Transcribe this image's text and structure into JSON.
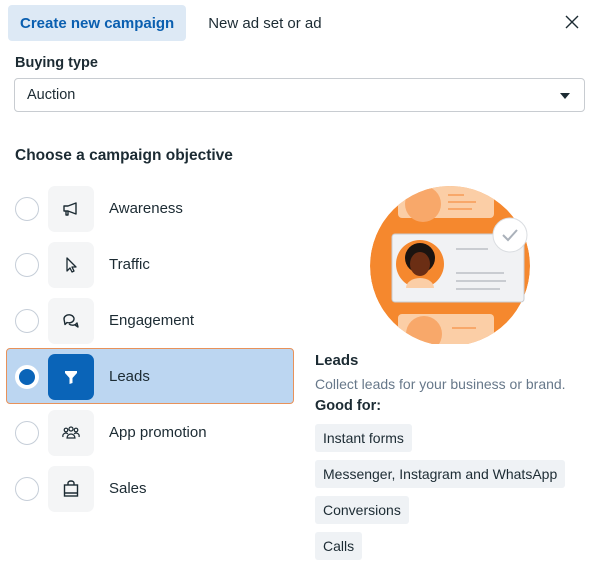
{
  "tabs": [
    {
      "label": "Create new campaign",
      "active": true
    },
    {
      "label": "New ad set or ad",
      "active": false
    }
  ],
  "close_icon": "close-icon",
  "buying_type": {
    "label": "Buying type",
    "value": "Auction"
  },
  "objective": {
    "heading": "Choose a campaign objective",
    "options": [
      {
        "label": "Awareness",
        "icon": "megaphone-icon",
        "selected": false
      },
      {
        "label": "Traffic",
        "icon": "cursor-icon",
        "selected": false
      },
      {
        "label": "Engagement",
        "icon": "chat-bubbles-icon",
        "selected": false
      },
      {
        "label": "Leads",
        "icon": "funnel-icon",
        "selected": true
      },
      {
        "label": "App promotion",
        "icon": "people-group-icon",
        "selected": false
      },
      {
        "label": "Sales",
        "icon": "shopping-bag-icon",
        "selected": false
      }
    ]
  },
  "detail": {
    "title": "Leads",
    "description": "Collect leads for your business or brand.",
    "good_for_label": "Good for:",
    "good_for": [
      "Instant forms",
      "Messenger, Instagram and WhatsApp",
      "Conversions",
      "Calls"
    ]
  },
  "colors": {
    "accent": "#0a64b8",
    "selected_bg": "#bcd6f1",
    "selected_border": "#e8925a",
    "illustration_orange": "#f5882e"
  }
}
